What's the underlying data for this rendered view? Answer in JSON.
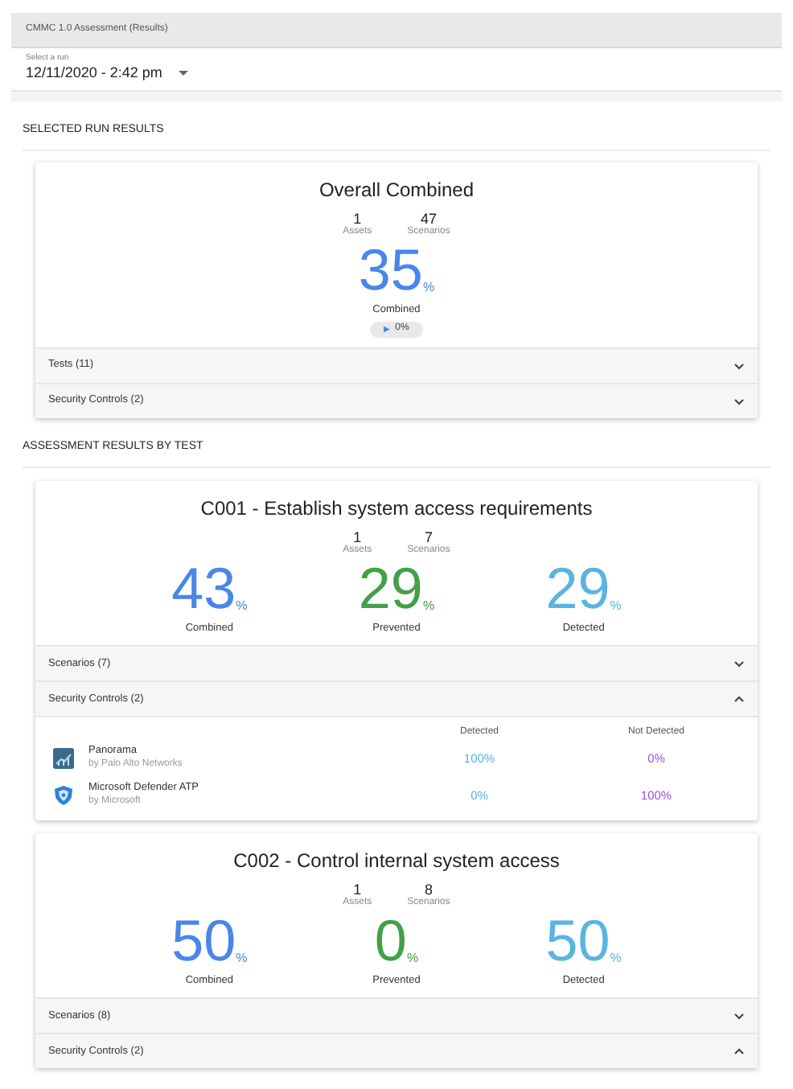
{
  "page_title": "CMMC 1.0 Assessment (Results)",
  "run_select": {
    "label": "Select a run",
    "value": "12/11/2020 - 2:42 pm"
  },
  "overall_section": {
    "heading": "SELECTED RUN RESULTS",
    "card": {
      "title": "Overall Combined",
      "counts": [
        {
          "value": "1",
          "label": "Assets"
        },
        {
          "value": "47",
          "label": "Scenarios"
        }
      ],
      "metrics": [
        {
          "kind": "combined",
          "value": "35",
          "unit": "%",
          "label": "Combined"
        }
      ],
      "trend": {
        "icon": "▶",
        "value": "0%"
      },
      "panels": [
        {
          "label": "Tests (11)",
          "expanded": false
        },
        {
          "label": "Security Controls (2)",
          "expanded": false
        }
      ]
    }
  },
  "tests_section": {
    "heading": "ASSESSMENT RESULTS BY TEST",
    "cards": [
      {
        "title": "C001 - Establish system access requirements",
        "counts": [
          {
            "value": "1",
            "label": "Assets"
          },
          {
            "value": "7",
            "label": "Scenarios"
          }
        ],
        "metrics": [
          {
            "kind": "combined",
            "value": "43",
            "unit": "%",
            "label": "Combined"
          },
          {
            "kind": "prevented",
            "value": "29",
            "unit": "%",
            "label": "Prevented"
          },
          {
            "kind": "detected",
            "value": "29",
            "unit": "%",
            "label": "Detected"
          }
        ],
        "panels": [
          {
            "label": "Scenarios (7)",
            "expanded": false
          },
          {
            "label": "Security Controls (2)",
            "expanded": true,
            "columns": [
              "Detected",
              "Not Detected"
            ],
            "rows": [
              {
                "kind": "panorama",
                "name": "Panorama",
                "vendor": "by Palo Alto Networks",
                "detected": "100%",
                "not_detected": "0%"
              },
              {
                "kind": "defender",
                "name": "Microsoft Defender ATP",
                "vendor": "by Microsoft",
                "detected": "0%",
                "not_detected": "100%"
              }
            ]
          }
        ]
      },
      {
        "title": "C002 - Control internal system access",
        "counts": [
          {
            "value": "1",
            "label": "Assets"
          },
          {
            "value": "8",
            "label": "Scenarios"
          }
        ],
        "metrics": [
          {
            "kind": "combined",
            "value": "50",
            "unit": "%",
            "label": "Combined"
          },
          {
            "kind": "prevented",
            "value": "0",
            "unit": "%",
            "label": "Prevented"
          },
          {
            "kind": "detected",
            "value": "50",
            "unit": "%",
            "label": "Detected"
          }
        ],
        "panels": [
          {
            "label": "Scenarios (8)",
            "expanded": false
          },
          {
            "label": "Security Controls (2)",
            "expanded": true
          }
        ]
      }
    ]
  }
}
